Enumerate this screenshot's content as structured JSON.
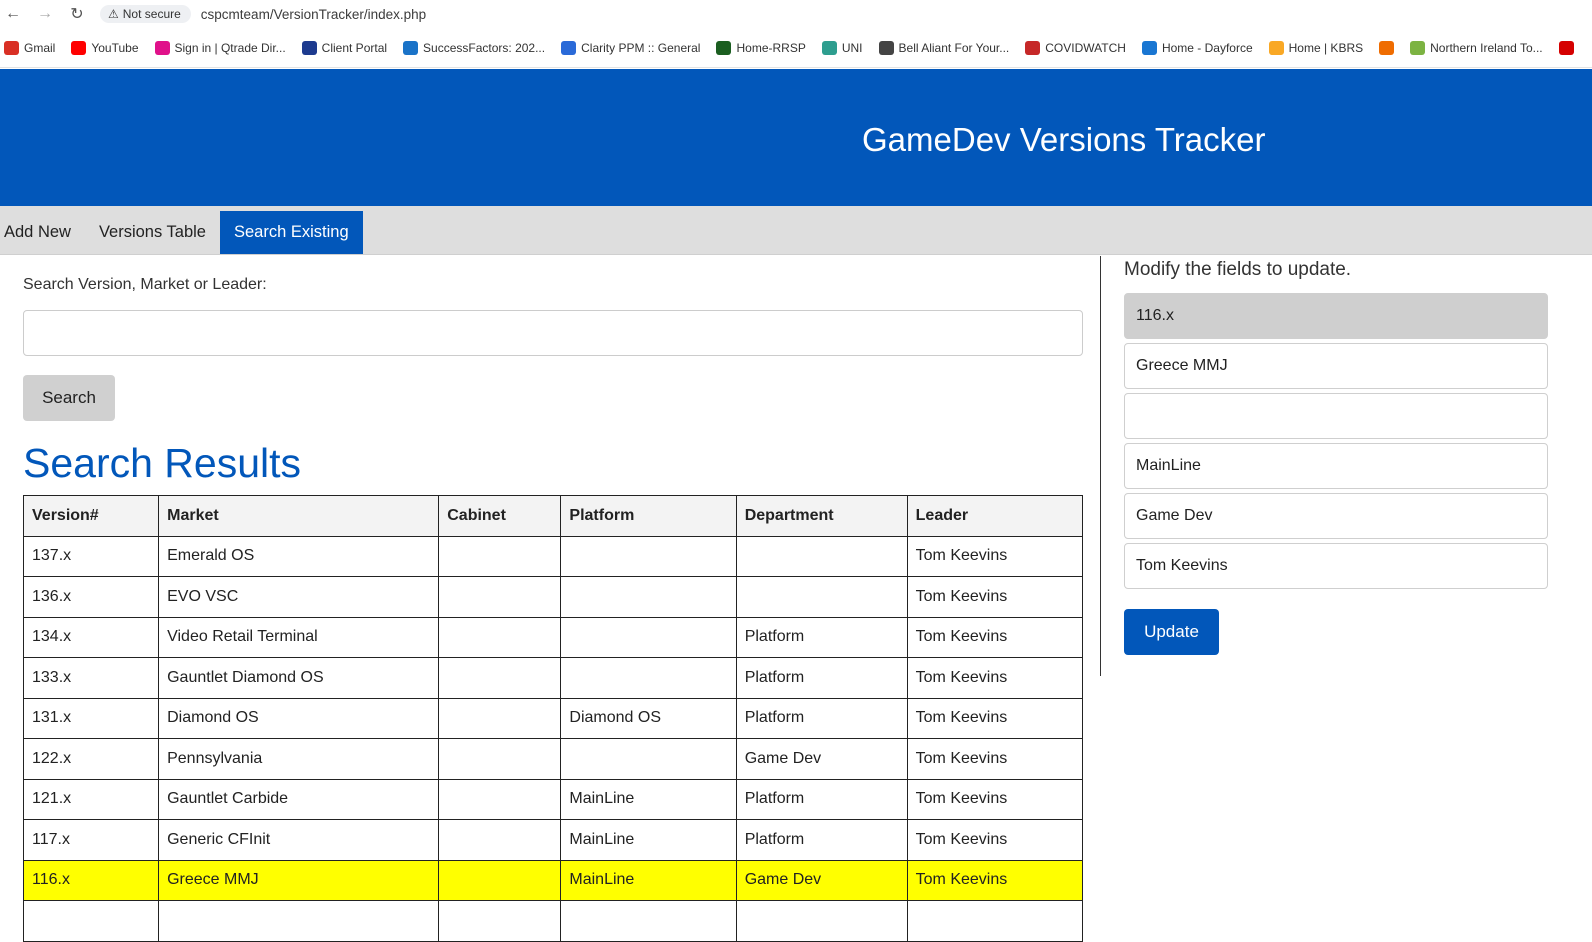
{
  "browser": {
    "security_label": "Not secure",
    "url": "cspcmteam/VersionTracker/index.php",
    "bookmarks": [
      {
        "label": "Gmail",
        "icon": "gmail-icon",
        "color": "#d93025"
      },
      {
        "label": "YouTube",
        "icon": "youtube-icon",
        "color": "#ff0000"
      },
      {
        "label": "Sign in | Qtrade Dir...",
        "icon": "qtrade-icon",
        "color": "#e0118a"
      },
      {
        "label": "Client Portal",
        "icon": "ia-icon",
        "color": "#1d3b8f"
      },
      {
        "label": "SuccessFactors: 202...",
        "icon": "sf-icon",
        "color": "#1a73c8"
      },
      {
        "label": "Clarity PPM :: General",
        "icon": "clarity-icon",
        "color": "#2a6ad8"
      },
      {
        "label": "Home-RRSP",
        "icon": "rrsp-icon",
        "color": "#1b5e20"
      },
      {
        "label": "UNI",
        "icon": "uni-icon",
        "color": "#2e9e8f"
      },
      {
        "label": "Bell Aliant For Your...",
        "icon": "bell-icon",
        "color": "#444444"
      },
      {
        "label": "COVIDWATCH",
        "icon": "covidwatch-icon",
        "color": "#c62828"
      },
      {
        "label": "Home - Dayforce",
        "icon": "dayforce-icon",
        "color": "#1976d2"
      },
      {
        "label": "Home | KBRS",
        "icon": "kbrs-icon",
        "color": "#f9a825"
      },
      {
        "label": "",
        "icon": "ev-icon",
        "color": "#ef6c00"
      },
      {
        "label": "Northern Ireland To...",
        "icon": "ni-icon",
        "color": "#7cb342"
      },
      {
        "label": "",
        "icon": "canada-icon",
        "color": "#d50000"
      }
    ]
  },
  "header": {
    "title": "GameDev Versions Tracker",
    "bg_color": "#0257ba"
  },
  "tabs": [
    {
      "label": "Add New",
      "active": false
    },
    {
      "label": "Versions Table",
      "active": false
    },
    {
      "label": "Search Existing",
      "active": true
    }
  ],
  "search": {
    "label": "Search Version, Market or Leader:",
    "value": "",
    "placeholder": "",
    "button_label": "Search"
  },
  "results": {
    "title": "Search Results",
    "columns": [
      "Version#",
      "Market",
      "Cabinet",
      "Platform",
      "Department",
      "Leader"
    ],
    "rows": [
      [
        "137.x",
        "Emerald OS",
        "",
        "",
        "",
        "Tom Keevins"
      ],
      [
        "136.x",
        "EVO VSC",
        "",
        "",
        "",
        "Tom Keevins"
      ],
      [
        "134.x",
        "Video Retail Terminal",
        "",
        "",
        "Platform",
        "Tom Keevins"
      ],
      [
        "133.x",
        "Gauntlet Diamond OS",
        "",
        "",
        "Platform",
        "Tom Keevins"
      ],
      [
        "131.x",
        "Diamond OS",
        "",
        "Diamond OS",
        "Platform",
        "Tom Keevins"
      ],
      [
        "122.x",
        "Pennsylvania",
        "",
        "",
        "Game Dev",
        "Tom Keevins"
      ],
      [
        "121.x",
        "Gauntlet Carbide",
        "",
        "MainLine",
        "Platform",
        "Tom Keevins"
      ],
      [
        "117.x",
        "Generic CFInit",
        "",
        "MainLine",
        "Platform",
        "Tom Keevins"
      ],
      [
        "116.x",
        "Greece MMJ",
        "",
        "MainLine",
        "Game Dev",
        "Tom Keevins"
      ],
      [
        "",
        "",
        "",
        "",
        "",
        ""
      ]
    ],
    "highlighted_row": 8,
    "highlight_color": "#ffff00"
  },
  "editor": {
    "label": "Modify the fields to update.",
    "fields": [
      {
        "value": "116.x",
        "readonly": true
      },
      {
        "value": "Greece MMJ",
        "readonly": false
      },
      {
        "value": "",
        "readonly": false
      },
      {
        "value": "MainLine",
        "readonly": false
      },
      {
        "value": "Game Dev",
        "readonly": false
      },
      {
        "value": "Tom Keevins",
        "readonly": false
      }
    ],
    "update_label": "Update"
  }
}
